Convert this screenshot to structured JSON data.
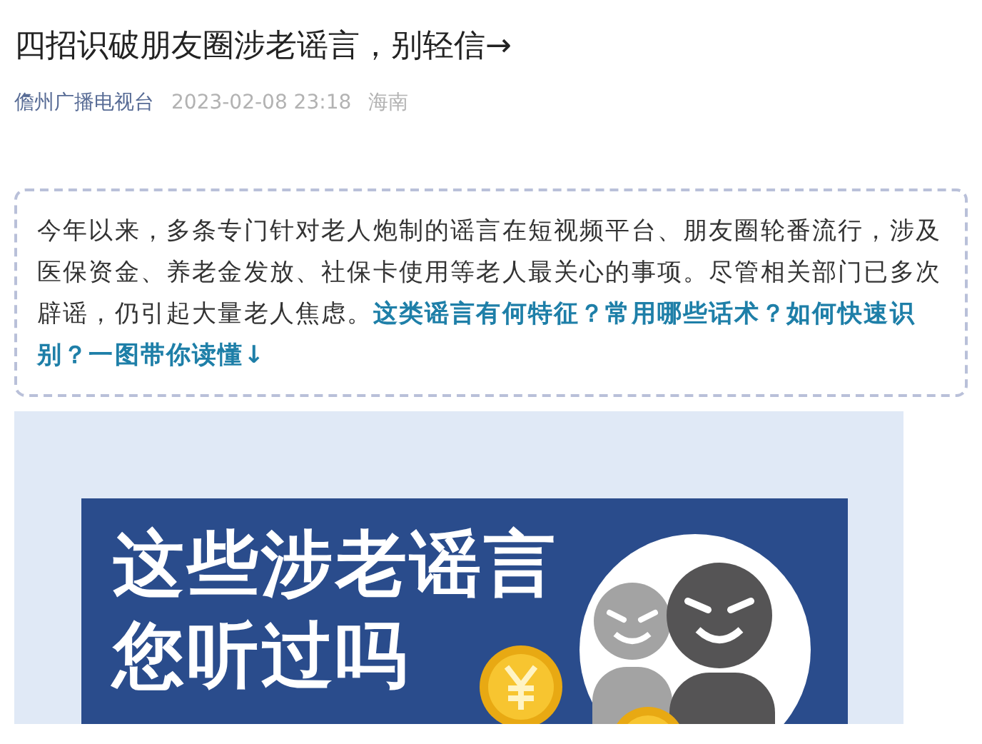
{
  "article": {
    "title": "四招识破朋友圈涉老谣言，别轻信→",
    "meta": {
      "account": "儋州广播电视台",
      "date": "2023-02-08 23:18",
      "location": "海南"
    },
    "intro": "今年以来，多条专门针对老人炮制的谣言在短视频平台、朋友圈轮番流行，涉及医保资金、养老金发放、社保卡使用等老人最关心的事项。尽管相关部门已多次辟谣，仍引起大量老人焦虑。**这类谣言有何特征？常用哪些话术？如何快速识别？一图带你读懂↓**",
    "poster": {
      "heading_lines": [
        "这些涉老谣言",
        "您听过吗"
      ]
    }
  }
}
